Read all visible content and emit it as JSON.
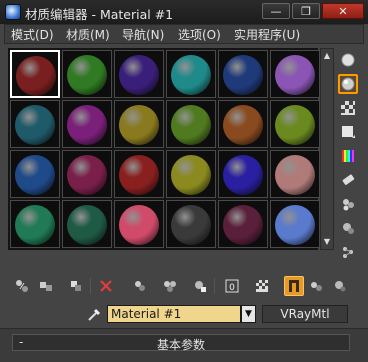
{
  "window": {
    "title": "材质编辑器 - Material #1",
    "minimize_label": "—",
    "restore_label": "❐",
    "close_label": "✕"
  },
  "menu": {
    "items": [
      {
        "label": "模式(D)"
      },
      {
        "label": "材质(M)"
      },
      {
        "label": "导航(N)"
      },
      {
        "label": "选项(O)"
      },
      {
        "label": "实用程序(U)"
      }
    ]
  },
  "slots": {
    "active_index": 0,
    "colors": [
      "#7a1f1f",
      "#2f7a22",
      "#3a1f7a",
      "#1f8a8a",
      "#1f3a7a",
      "#8a55b5",
      "#1f5a6a",
      "#7a1f7a",
      "#8a7a1f",
      "#4f7a1f",
      "#8a4a1f",
      "#6a8a1f",
      "#1f4a8a",
      "#7a1f4a",
      "#8a1f1f",
      "#8a8a1f",
      "#2a1fa0",
      "#b07a78",
      "#1f7a55",
      "#1f5a45",
      "#d04a6a",
      "#3a3a3a",
      "#5a1f3a",
      "#5a7acd"
    ]
  },
  "scrollbar": {
    "up": "▲",
    "down": "▼"
  },
  "right_tools": [
    "sample-type-icon",
    "backlight-icon",
    "background-icon",
    "uv-tiling-icon",
    "video-check-icon",
    "make-preview-icon",
    "options-icon",
    "select-by-material-icon",
    "navigator-icon"
  ],
  "bottom_tools": [
    "get-material-icon",
    "put-to-scene-icon",
    "assign-to-selection-icon",
    "reset-icon",
    "make-unique-icon",
    "copy-material-icon",
    "put-to-library-icon",
    "material-id-icon",
    "show-map-icon",
    "show-end-result-icon",
    "go-to-parent-icon",
    "go-forward-icon"
  ],
  "material": {
    "name": "Material #1",
    "type": "VRayMtl",
    "dropdown_arrow": "▼"
  },
  "rollout": {
    "toggle": "-",
    "title": "基本参数"
  }
}
